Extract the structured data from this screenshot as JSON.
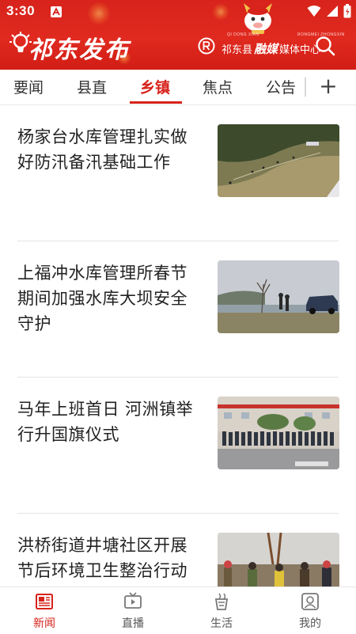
{
  "status_bar": {
    "time": "3:30"
  },
  "header": {
    "app_title": "祁东发布",
    "media_center": {
      "prefix": "祁东县",
      "stylized": "融媒",
      "suffix": "媒体中心",
      "small_text_left": "QI DONG XIAN",
      "small_text_right": "RONGMEI ZHONGXIN"
    },
    "colors": {
      "brand_red": "#d7231b",
      "text_on_brand": "#ffffff"
    },
    "icons": [
      "lightbulb-icon",
      "registered-logo-icon",
      "search-icon",
      "mascot-icon"
    ]
  },
  "tabs": {
    "items": [
      {
        "label": "要闻",
        "active": false
      },
      {
        "label": "县直",
        "active": false
      },
      {
        "label": "乡镇",
        "active": true
      },
      {
        "label": "焦点",
        "active": false
      },
      {
        "label": "公告",
        "active": false
      }
    ],
    "add_label": "+"
  },
  "news": [
    {
      "title": "杨家台水库管理扎实做好防汛备汛基础工作",
      "thumb": "hillside-workers"
    },
    {
      "title": "上福冲水库管理所春节期间加强水库大坝安全守护",
      "thumb": "dam-inspection"
    },
    {
      "title": "马年上班首日 河洲镇举行升国旗仪式",
      "thumb": "flag-ceremony"
    },
    {
      "title": "洪桥街道井塘社区开展节后环境卫生整治行动",
      "thumb": "street-cleanup"
    }
  ],
  "bottom_nav": [
    {
      "label": "新闻",
      "icon": "newspaper-icon",
      "active": true
    },
    {
      "label": "直播",
      "icon": "tv-icon",
      "active": false
    },
    {
      "label": "生活",
      "icon": "life-icon",
      "active": false
    },
    {
      "label": "我的",
      "icon": "profile-icon",
      "active": false
    }
  ]
}
